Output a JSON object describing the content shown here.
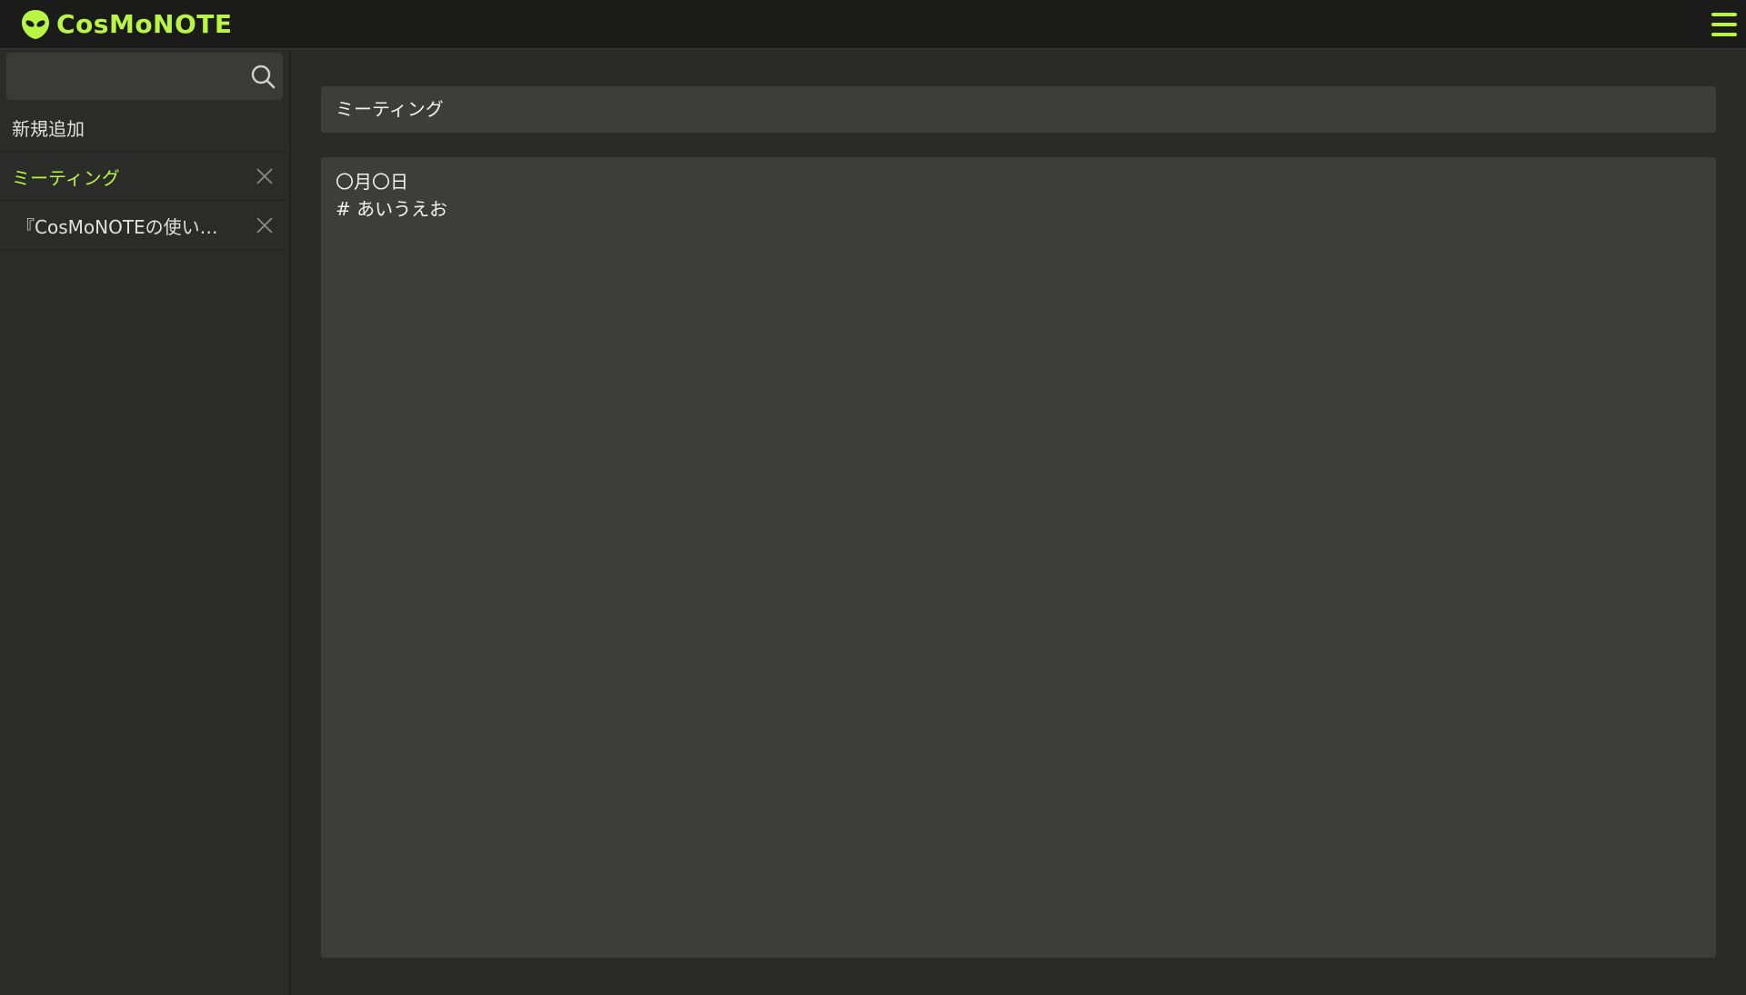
{
  "app": {
    "logo_text": "CosMoNOTE",
    "accent_color": "#b9f545",
    "menu_icon": "hamburger-menu-icon"
  },
  "sidebar": {
    "search": {
      "placeholder": "",
      "value": "",
      "icon": "search-icon"
    },
    "new_item_label": "新規追加",
    "notes": [
      {
        "title": "ミーティング",
        "active": true
      },
      {
        "title": "『CosMoNOTEの使い…",
        "active": false
      }
    ]
  },
  "main": {
    "title": "ミーティング",
    "body_lines": [
      "〇月〇日",
      "# あいうえお"
    ]
  }
}
